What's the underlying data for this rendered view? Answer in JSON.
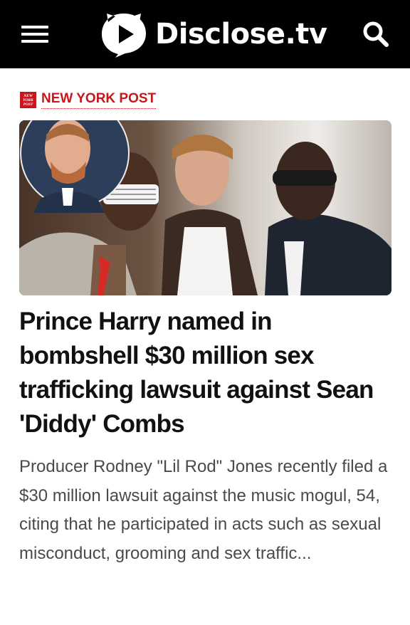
{
  "header": {
    "brand": "Disclose.tv",
    "menu_icon": "hamburger-menu-icon",
    "search_icon": "search-icon"
  },
  "article": {
    "source_name": "NEW YORK POST",
    "source_logo_text": [
      "NEW",
      "YORK",
      "POST"
    ],
    "image_alt": "Prince Harry, Kanye West and Sean Combs",
    "headline": "Prince Harry named in bombshell $30 million sex trafficking lawsuit against Sean 'Diddy' Combs",
    "summary": "Producer Rodney \"Lil Rod\" Jones recently filed a $30 million lawsuit against the music mogul, 54, citing that he participated in acts such as sexual misconduct, grooming and sex traffic..."
  },
  "colors": {
    "header_bg": "#000000",
    "source_red": "#c8161d",
    "headline": "#111111",
    "summary": "#4a4a4a"
  }
}
